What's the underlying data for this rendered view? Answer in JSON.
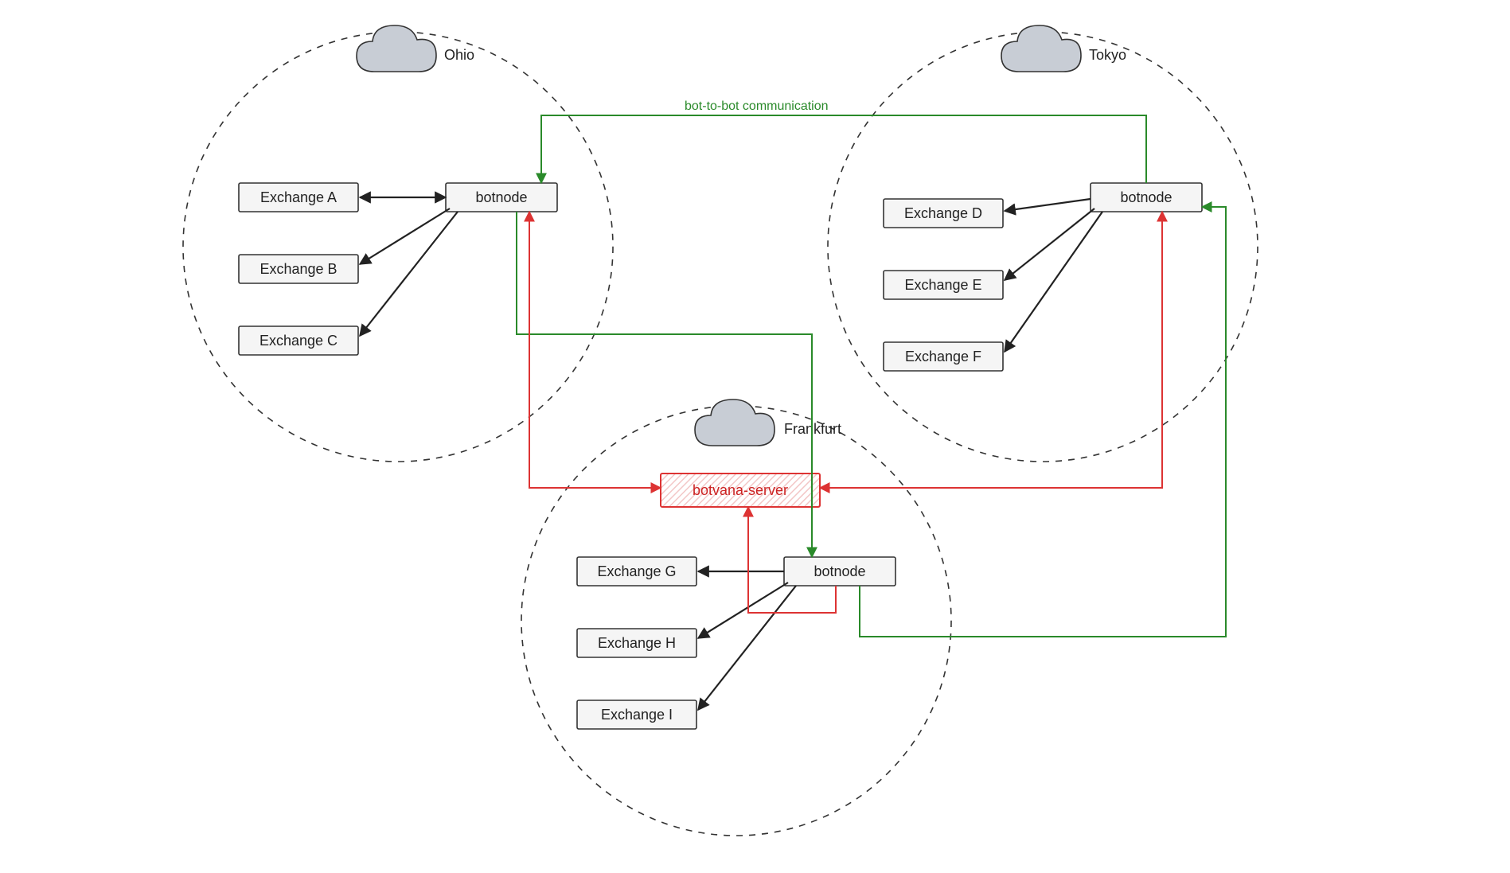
{
  "diagram": {
    "connection_label": "bot-to-bot communication",
    "server": {
      "label": "botvana-server"
    },
    "regions": {
      "ohio": {
        "name": "Ohio",
        "botnode_label": "botnode",
        "exchanges": [
          "Exchange A",
          "Exchange B",
          "Exchange C"
        ]
      },
      "tokyo": {
        "name": "Tokyo",
        "botnode_label": "botnode",
        "exchanges": [
          "Exchange D",
          "Exchange E",
          "Exchange F"
        ]
      },
      "frankfurt": {
        "name": "Frankfurt",
        "botnode_label": "botnode",
        "exchanges": [
          "Exchange G",
          "Exchange H",
          "Exchange I"
        ]
      }
    },
    "colors": {
      "bot_to_bot": "#2a8a2a",
      "to_server": "#d33",
      "to_exchange": "#222222",
      "box_fill": "#f5f5f5",
      "cloud_fill": "#c8cdd5"
    }
  }
}
